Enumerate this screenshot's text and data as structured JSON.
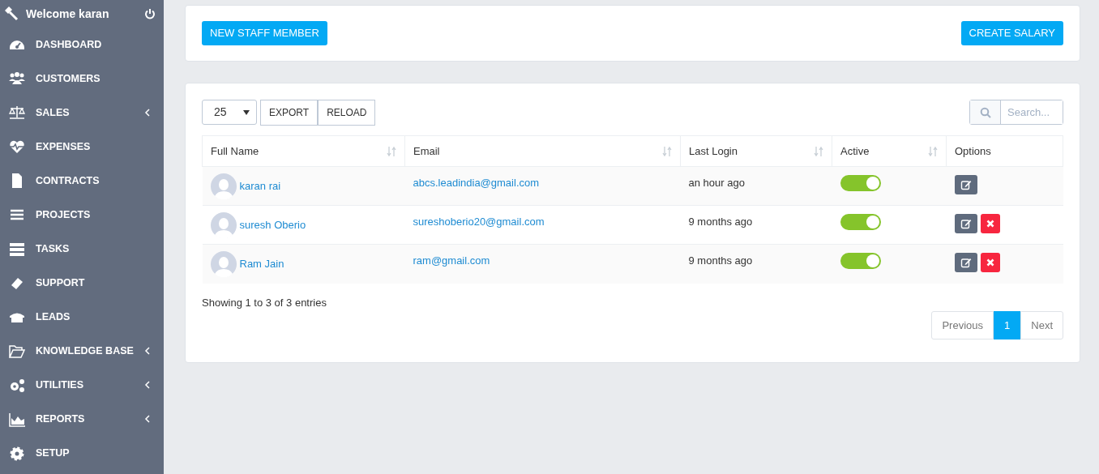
{
  "sidebar": {
    "welcome": "Welcome karan",
    "items": [
      {
        "label": "DASHBOARD",
        "submenu": false
      },
      {
        "label": "CUSTOMERS",
        "submenu": false
      },
      {
        "label": "SALES",
        "submenu": true
      },
      {
        "label": "EXPENSES",
        "submenu": false
      },
      {
        "label": "CONTRACTS",
        "submenu": false
      },
      {
        "label": "PROJECTS",
        "submenu": false
      },
      {
        "label": "TASKS",
        "submenu": false
      },
      {
        "label": "SUPPORT",
        "submenu": false
      },
      {
        "label": "LEADS",
        "submenu": false
      },
      {
        "label": "KNOWLEDGE BASE",
        "submenu": true
      },
      {
        "label": "UTILITIES",
        "submenu": true
      },
      {
        "label": "REPORTS",
        "submenu": true
      },
      {
        "label": "SETUP",
        "submenu": false
      }
    ]
  },
  "actions": [
    "NEW STAFF MEMBER",
    "CREATE SALARY"
  ],
  "table_tools": {
    "page_size": "25",
    "buttons": [
      "EXPORT",
      "RELOAD"
    ],
    "search": {
      "placeholder": "Search..."
    }
  },
  "table": {
    "columns": [
      {
        "label": "Full Name",
        "sortable": true
      },
      {
        "label": "Email",
        "sortable": true
      },
      {
        "label": "Last Login",
        "sortable": true
      },
      {
        "label": "Active",
        "sortable": true
      },
      {
        "label": "Options",
        "sortable": false
      }
    ],
    "rows": [
      {
        "name": "karan rai",
        "email": "abcs.leadindia@gmail.com",
        "last_login": "an hour ago",
        "active": true,
        "deletable": false
      },
      {
        "name": "suresh Oberio",
        "email": "sureshoberio20@gmail.com",
        "last_login": "9 months ago",
        "active": true,
        "deletable": true
      },
      {
        "name": "Ram Jain",
        "email": "ram@gmail.com",
        "last_login": "9 months ago",
        "active": true,
        "deletable": true
      }
    ]
  },
  "summary": "Showing 1 to 3 of 3 entries",
  "pagination": [
    {
      "label": "Previous",
      "selected": false
    },
    {
      "label": "1",
      "selected": true
    },
    {
      "label": "Next",
      "selected": false
    }
  ]
}
